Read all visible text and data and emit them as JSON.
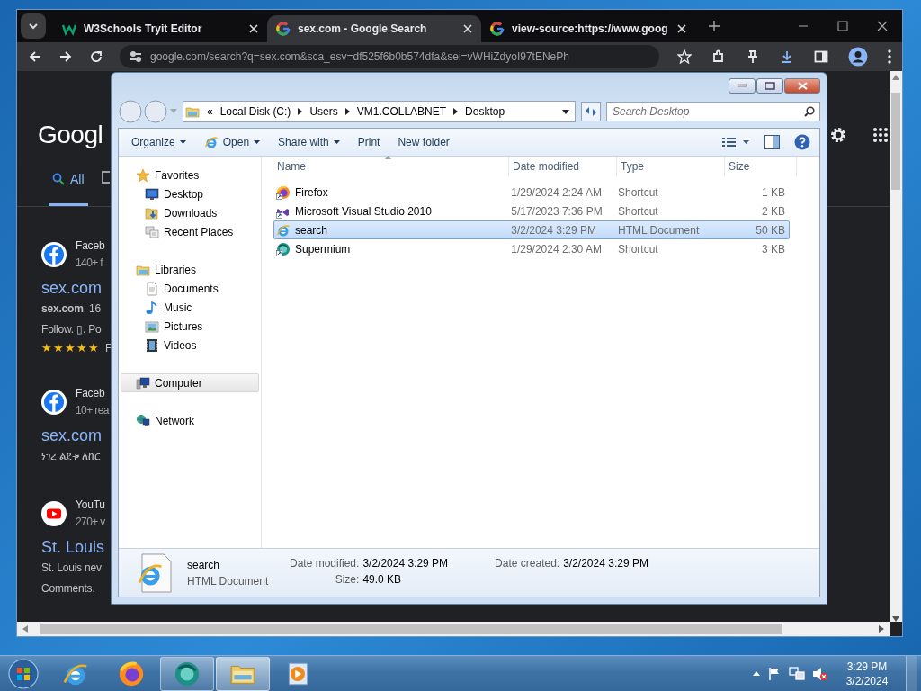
{
  "browser": {
    "tabs": [
      {
        "title": "W3Schools Tryit Editor",
        "selected": false,
        "kind": "w3schools"
      },
      {
        "title": "sex.com - Google Search",
        "selected": true,
        "kind": "google"
      },
      {
        "title": "view-source:https://www.goog",
        "selected": false,
        "kind": "google"
      }
    ],
    "address": "google.com/search?q=sex.com&sca_esv=df525f6b0b574dfa&sei=vWHiZdyoI97tENePh",
    "page": {
      "logo": "Googl",
      "nav_tabs": [
        {
          "label": "All",
          "selected": true
        }
      ],
      "results": [
        {
          "kind": "facebook",
          "source": "Faceb",
          "meta": "140+ f",
          "title": "sex.com",
          "lines": [
            "**sex.com**. 16",
            "Follow. ▯. Po"
          ],
          "stars": 5,
          "after_stars": "F"
        },
        {
          "kind": "facebook",
          "source": "Faceb",
          "meta": "10+ rea",
          "title": "sex.com",
          "lines": [
            "ነገረ ልደቱ ለከር"
          ]
        },
        {
          "kind": "youtube",
          "source": "YouTu",
          "meta": "270+ v",
          "title": "St. Louis",
          "lines": [
            "St. Louis nev",
            "Comments."
          ]
        }
      ]
    }
  },
  "explorer": {
    "breadcrumb": {
      "overflow": "«",
      "parts": [
        "Local Disk (C:)",
        "Users",
        "VM1.COLLABNET",
        "Desktop"
      ]
    },
    "search_placeholder": "Search Desktop",
    "toolbar": [
      {
        "label": "Organize",
        "dropdown": true
      },
      {
        "label": "Open",
        "kind": "ie",
        "dropdown": true
      },
      {
        "label": "Share with",
        "dropdown": true
      },
      {
        "label": "Print",
        "dropdown": false
      },
      {
        "label": "New folder",
        "dropdown": false
      }
    ],
    "nav": [
      {
        "label": "Favorites",
        "kind": "star",
        "selected": false,
        "children": [
          {
            "label": "Desktop",
            "kind": "desktop",
            "selected": false
          },
          {
            "label": "Downloads",
            "kind": "downloads",
            "selected": false
          },
          {
            "label": "Recent Places",
            "kind": "recent",
            "selected": false
          }
        ]
      },
      {
        "label": "Libraries",
        "kind": "libraries",
        "selected": false,
        "children": [
          {
            "label": "Documents",
            "kind": "documents",
            "selected": false
          },
          {
            "label": "Music",
            "kind": "music",
            "selected": false
          },
          {
            "label": "Pictures",
            "kind": "pictures",
            "selected": false
          },
          {
            "label": "Videos",
            "kind": "videos",
            "selected": false
          }
        ]
      },
      {
        "label": "Computer",
        "kind": "computer",
        "selected": true
      },
      {
        "label": "Network",
        "kind": "network",
        "selected": false
      }
    ],
    "columns": [
      {
        "label": "Name",
        "sorted": true
      },
      {
        "label": "Date modified",
        "sorted": false
      },
      {
        "label": "Type",
        "sorted": false
      },
      {
        "label": "Size",
        "sorted": false
      }
    ],
    "files": [
      {
        "name": "Firefox",
        "date": "1/29/2024 2:24 AM",
        "type": "Shortcut",
        "size": "1 KB",
        "kind": "firefox",
        "selected": false
      },
      {
        "name": "Microsoft Visual Studio 2010",
        "date": "5/17/2023 7:36 PM",
        "type": "Shortcut",
        "size": "2 KB",
        "kind": "vs",
        "selected": false
      },
      {
        "name": "search",
        "date": "3/2/2024 3:29 PM",
        "type": "HTML Document",
        "size": "50 KB",
        "kind": "ie",
        "selected": true
      },
      {
        "name": "Supermium",
        "date": "1/29/2024 2:30 AM",
        "type": "Shortcut",
        "size": "3 KB",
        "kind": "supermium",
        "selected": false
      }
    ],
    "details": {
      "name": "search",
      "type": "HTML Document",
      "fields": [
        {
          "label": "Date modified:",
          "value": "3/2/2024 3:29 PM"
        },
        {
          "label": "Size:",
          "value": "49.0 KB"
        },
        {
          "label": "Date created:",
          "value": "3/2/2024 3:29 PM"
        }
      ]
    }
  },
  "taskbar": {
    "apps": [
      {
        "kind": "ie",
        "running": false,
        "selected": false
      },
      {
        "kind": "firefox",
        "running": false,
        "selected": false
      },
      {
        "kind": "supermium",
        "running": true,
        "selected": false
      },
      {
        "kind": "explorer",
        "running": true,
        "selected": true
      },
      {
        "kind": "media",
        "running": false,
        "selected": false
      }
    ],
    "time": "3:29 PM",
    "date": "3/2/2024"
  }
}
